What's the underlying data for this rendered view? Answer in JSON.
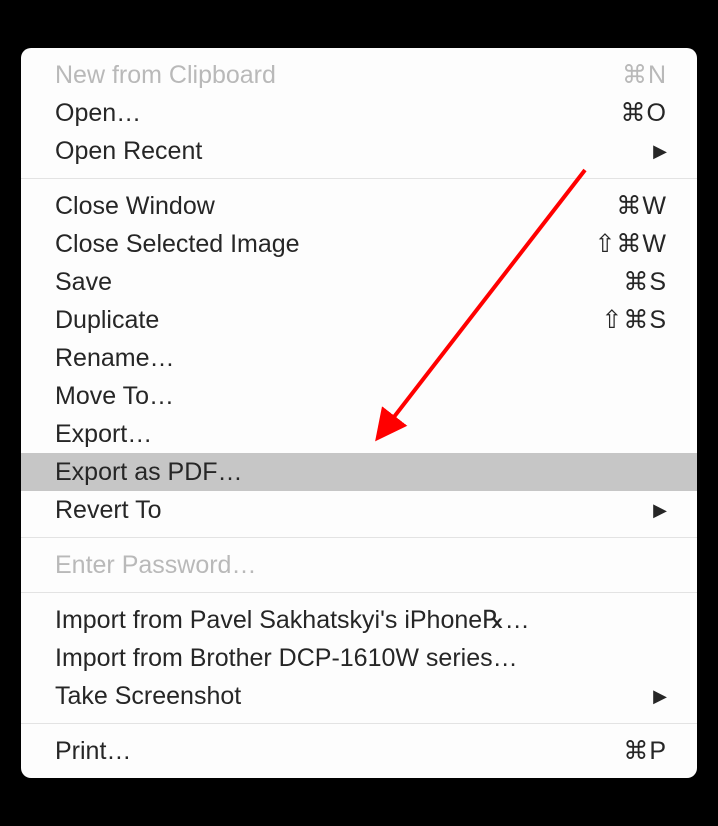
{
  "menu": {
    "groups": [
      {
        "items": [
          {
            "id": "new-from-clipboard",
            "label": "New from Clipboard",
            "shortcut": "⌘N",
            "disabled": true
          },
          {
            "id": "open",
            "label": "Open…",
            "shortcut": "⌘O"
          },
          {
            "id": "open-recent",
            "label": "Open Recent",
            "submenu": true
          }
        ]
      },
      {
        "items": [
          {
            "id": "close-window",
            "label": "Close Window",
            "shortcut": "⌘W"
          },
          {
            "id": "close-selected-image",
            "label": "Close Selected Image",
            "shortcut": "⇧⌘W"
          },
          {
            "id": "save",
            "label": "Save",
            "shortcut": "⌘S"
          },
          {
            "id": "duplicate",
            "label": "Duplicate",
            "shortcut": "⇧⌘S"
          },
          {
            "id": "rename",
            "label": "Rename…"
          },
          {
            "id": "move-to",
            "label": "Move To…"
          },
          {
            "id": "export",
            "label": "Export…"
          },
          {
            "id": "export-as-pdf",
            "label": "Export as PDF…",
            "highlighted": true
          },
          {
            "id": "revert-to",
            "label": "Revert To",
            "submenu": true
          }
        ]
      },
      {
        "items": [
          {
            "id": "enter-password",
            "label": "Enter Password…",
            "disabled": true
          }
        ]
      },
      {
        "items": [
          {
            "id": "import-iphone",
            "label": "Import from Pavel Sakhatskyi's iPhone℞…"
          },
          {
            "id": "import-printer",
            "label": "Import from Brother DCP-1610W series…"
          },
          {
            "id": "take-screenshot",
            "label": "Take Screenshot",
            "submenu": true
          }
        ]
      },
      {
        "items": [
          {
            "id": "print",
            "label": "Print…",
            "shortcut": "⌘P"
          }
        ]
      }
    ]
  },
  "annotation": {
    "arrow_color": "#ff0000",
    "target_item": "export-as-pdf"
  }
}
